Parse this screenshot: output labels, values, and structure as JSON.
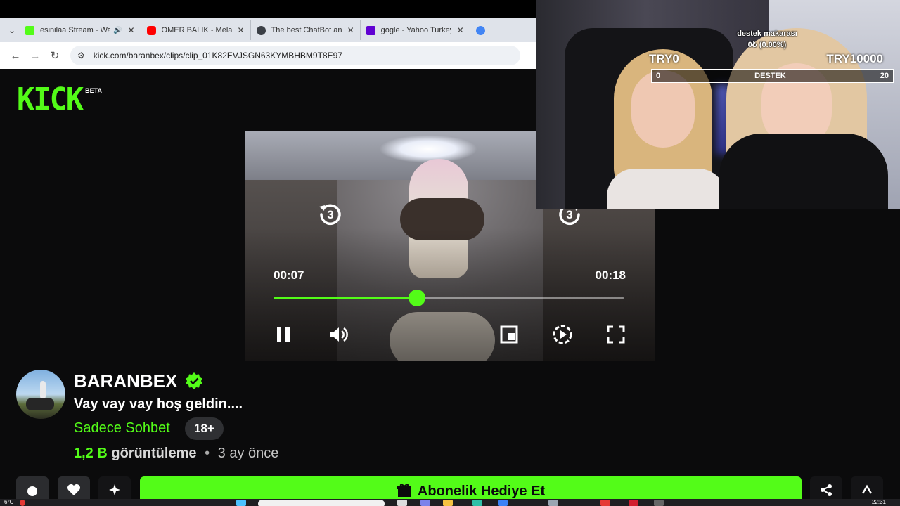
{
  "browser": {
    "tabs": [
      {
        "title": "esinilaa Stream - Watch",
        "favicon_color": "#53fc18",
        "audio": true
      },
      {
        "title": "OMER BALIK - Melancholy",
        "favicon_color": "#ff0000",
        "audio": false
      },
      {
        "title": "The best ChatBot and Wid",
        "favicon_color": "#3b3f46",
        "audio": false
      },
      {
        "title": "gogle - Yahoo Turkey Aran",
        "favicon_color": "#6001d2",
        "audio": false
      },
      {
        "title": "",
        "favicon_color": "#4285f4",
        "audio": false
      }
    ],
    "url": "kick.com/baranbex/clips/clip_01K82EVJSGN63KYMBHBM9T8E97"
  },
  "kick": {
    "logo_text": "KICK",
    "beta_label": "BETA",
    "accent": "#53fc18"
  },
  "player": {
    "current_time": "00:07",
    "duration": "00:18",
    "progress_fraction": 0.41,
    "replay_seconds": "3",
    "forward_seconds": "3"
  },
  "overlay": {
    "donation_title": "destek makarası",
    "donation_amount": "0₺ (0.00%)",
    "goal_left": "TRY0",
    "goal_right": "TRY10000",
    "bar_min": "0",
    "bar_label": "DESTEK",
    "bar_max": "20"
  },
  "channel": {
    "name": "BARANBEX",
    "clip_title": "Vay vay vay hoş geldin....",
    "category": "Sadece Sohbet",
    "age_badge": "18+",
    "views_count": "1,2 B",
    "views_label": "görüntüleme",
    "separator": "•",
    "posted_ago": "3 ay önce"
  },
  "actions": {
    "gift_label": "Abonelik Hediye Et"
  },
  "taskbar": {
    "weather": "6°C",
    "clock": "22:31",
    "notification_count": "2"
  }
}
